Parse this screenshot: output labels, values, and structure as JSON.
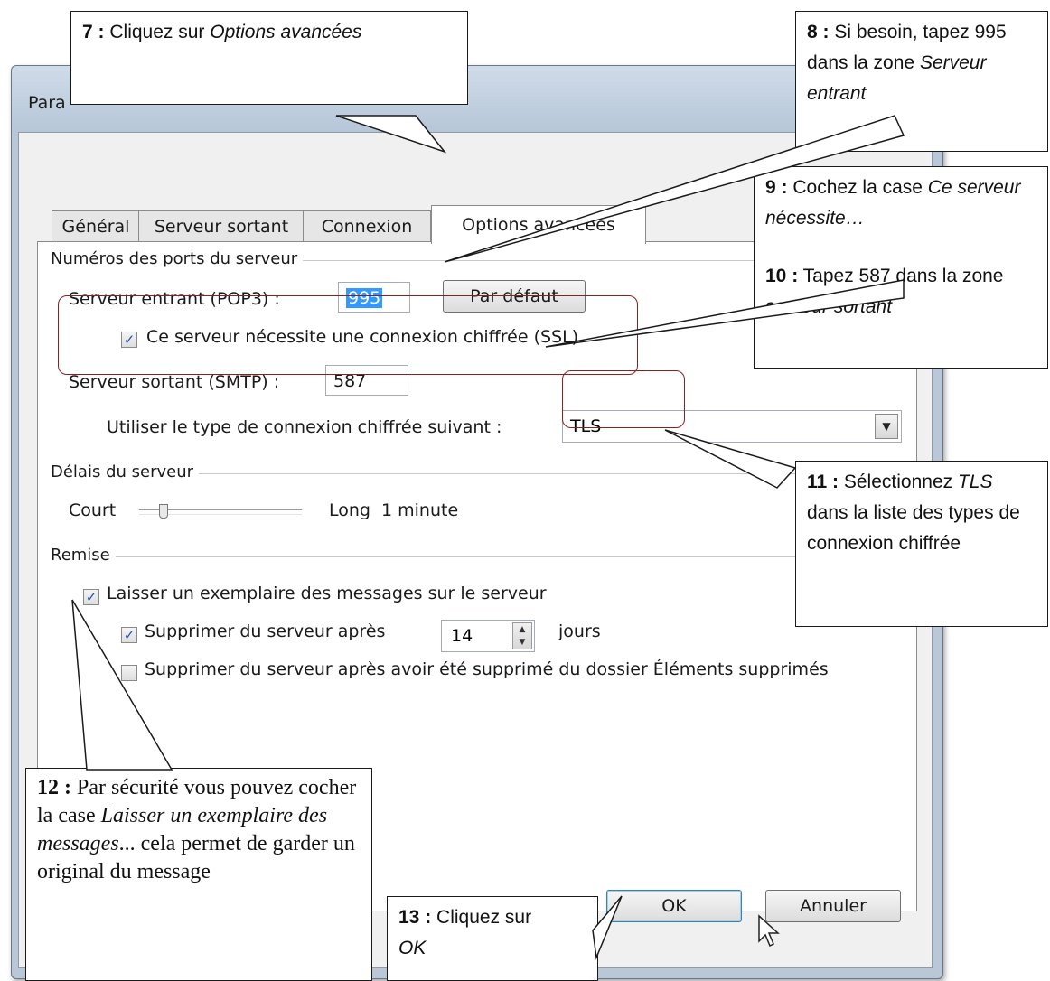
{
  "window": {
    "title": "Para"
  },
  "tabs": [
    {
      "label": "Général"
    },
    {
      "label": "Serveur sortant"
    },
    {
      "label": "Connexion"
    },
    {
      "label": "Options avancées"
    }
  ],
  "ports": {
    "group_label": "Numéros des ports du serveur",
    "incoming_label": "Serveur entrant (POP3) :",
    "incoming_value": "995",
    "default_button": "Par défaut",
    "ssl_checkbox_label": "Ce serveur nécessite une connexion chiffrée (SSL).",
    "ssl_checked": true,
    "outgoing_label": "Serveur sortant (SMTP) :",
    "outgoing_value": "587",
    "encryption_label": "Utiliser le type de connexion chiffrée suivant :",
    "encryption_value": "TLS"
  },
  "timeout": {
    "group_label": "Délais du serveur",
    "short_label": "Court",
    "long_label": "Long",
    "value_label": "1 minute"
  },
  "delivery": {
    "group_label": "Remise",
    "leave_copy_label": "Laisser un exemplaire des messages sur le serveur",
    "leave_copy_checked": true,
    "remove_after_label": "Supprimer du serveur après",
    "remove_after_checked": true,
    "remove_after_days": "14",
    "days_label": "jours",
    "remove_deleted_label": "Supprimer du serveur après avoir été supprimé du dossier Éléments supprimés",
    "remove_deleted_checked": false
  },
  "buttons": {
    "ok": "OK",
    "cancel": "Annuler"
  },
  "callouts": {
    "c7": {
      "num": "7 :",
      "text": "Cliquez sur ",
      "em": "Options avancées"
    },
    "c8": {
      "num": "8 :",
      "text": "Si besoin, tapez 995 dans la zone",
      "em": "Serveur entrant"
    },
    "c9": {
      "num": "9 :",
      "text": "Cochez la case ",
      "em": "Ce serveur nécessite…"
    },
    "c10": {
      "num": "10 :",
      "text": "Tapez 587 dans la zone ",
      "em": "serveur sortant"
    },
    "c11": {
      "num": "11 :",
      "text": "Sélectionnez",
      "em": "TLS",
      "text2": "dans la liste des types de connexion chiffrée"
    },
    "c12": {
      "num": "12 :",
      "text": "Par sécurité vous pouvez cocher la case",
      "em": "Laisser un exemplaire des messages",
      "text2": "... cela permet de garder un original du message"
    },
    "c13": {
      "num": "13 :",
      "text": "Cliquez sur",
      "em": "OK"
    }
  },
  "colors": {
    "highlight": "#8b2020",
    "selection": "#3399ff",
    "check": "#2350a6"
  }
}
